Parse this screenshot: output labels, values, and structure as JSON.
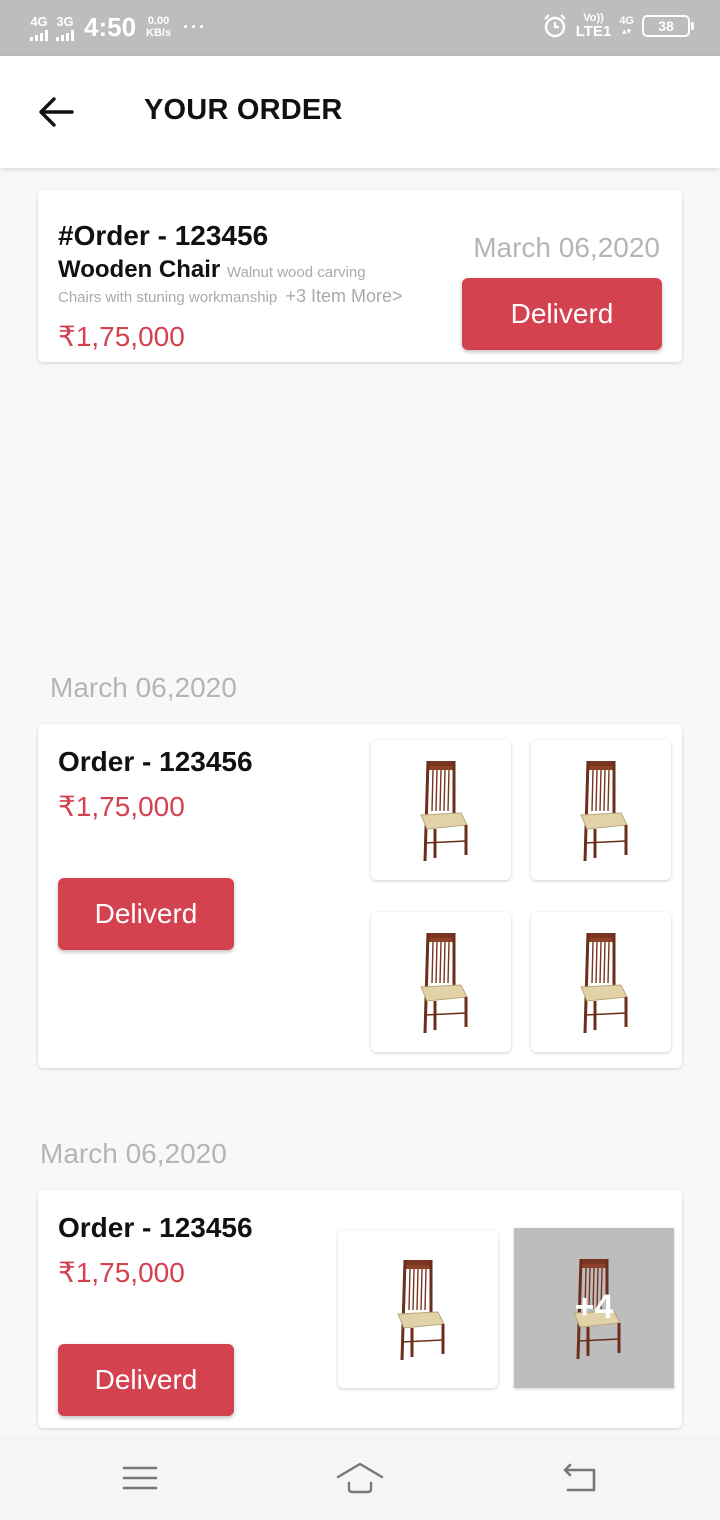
{
  "status_bar": {
    "sim1": "4G",
    "sim2": "3G",
    "time": "4:50",
    "speed_value": "0.00",
    "speed_unit": "KB/s",
    "more": "···",
    "volte_top": "Vo))",
    "volte_bottom": "LTE1",
    "network": "4G",
    "battery": "38"
  },
  "header": {
    "title": "YOUR ORDER"
  },
  "order_summary": {
    "order_id": "#Order - 123456",
    "product_name": "Wooden Chair",
    "product_subtitle": "Walnut wood carving",
    "description": "Chairs with stuning workmanship",
    "more_items": "+3 Item More>",
    "price": "₹1,75,000",
    "date": "March 06,2020",
    "status_label": "Deliverd"
  },
  "order_groups": [
    {
      "date": "March 06,2020",
      "order_id": "Order - 123456",
      "price": "₹1,75,000",
      "status_label": "Deliverd",
      "extra_count": ""
    },
    {
      "date": "March 06,2020",
      "order_id": "Order - 123456",
      "price": "₹1,75,000",
      "status_label": "Deliverd",
      "extra_count": "+4"
    }
  ],
  "colors": {
    "accent": "#d4424f",
    "muted_text": "#b5b5b5",
    "status_bar": "#bdbdbd"
  },
  "icons": {
    "back": "arrow-left-icon",
    "product": "chair-icon",
    "nav_menu": "menu-icon",
    "nav_home": "home-icon",
    "nav_back": "back-icon"
  }
}
